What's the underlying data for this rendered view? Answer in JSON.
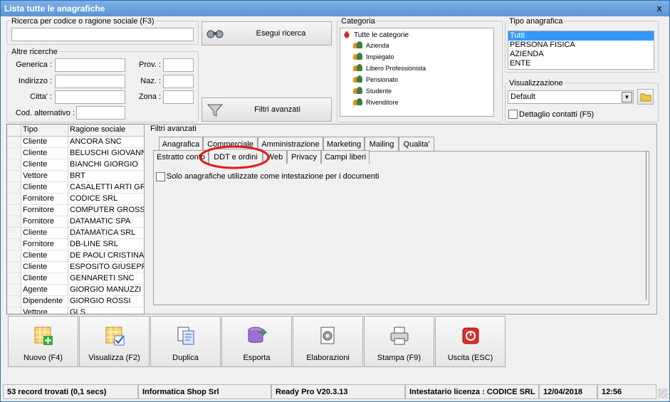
{
  "window": {
    "title": "Lista tutte le anagrafiche",
    "close_glyph": "x"
  },
  "search": {
    "legend": "Ricerca per codice o ragione sociale (F3)",
    "value": "",
    "button_label": "Esegui ricerca"
  },
  "altre": {
    "legend": "Altre ricerche",
    "generica_label": "Generica :",
    "indirizzo_label": "Indirizzo :",
    "citta_label": "Citta' :",
    "codalt_label": "Cod. alternativo :",
    "prov_label": "Prov. :",
    "naz_label": "Naz. :",
    "zona_label": "Zona :"
  },
  "filtri_button": "Filtri avanzati",
  "categoria": {
    "legend": "Categoria",
    "root": "Tutte le categorie",
    "items": [
      "Azienda",
      "Impiegato",
      "Libero Professionista",
      "Pensionato",
      "Studente",
      "Rivenditore"
    ]
  },
  "tipo": {
    "legend": "Tipo anagrafica",
    "items": [
      "Tutti",
      "PERSONA FISICA",
      "AZIENDA",
      "ENTE"
    ],
    "selected": "Tutti"
  },
  "visualizzazione": {
    "legend": "Visualizzazione",
    "value": "Default",
    "dettaglio_label": "Dettaglio contatti (F5)"
  },
  "grid": {
    "headers": [
      "Tipo",
      "Ragione sociale"
    ],
    "rows": [
      [
        "Cliente",
        "ANCORA SNC"
      ],
      [
        "Cliente",
        "BELUSCHI GIOVANNI"
      ],
      [
        "Cliente",
        "BIANCHI GIORGIO"
      ],
      [
        "Vettore",
        "BRT"
      ],
      [
        "Cliente",
        "CASALETTI ARTI GRA"
      ],
      [
        "Fornitore",
        "CODICE SRL"
      ],
      [
        "Fornitore",
        "COMPUTER GROSS SP"
      ],
      [
        "Fornitore",
        "DATAMATIC SPA"
      ],
      [
        "Cliente",
        "DATAMATICA SRL"
      ],
      [
        "Fornitore",
        "DB-LINE SRL"
      ],
      [
        "Cliente",
        "DE PAOLI CRISTINA"
      ],
      [
        "Cliente",
        "ESPOSITO GIUSEPPE"
      ],
      [
        "Cliente",
        "GENNARETI SNC"
      ],
      [
        "Agente",
        "GIORGIO MANUZZI (C"
      ],
      [
        "Dipendente",
        "GIORGIO ROSSI"
      ],
      [
        "Vettore",
        "GLS"
      ]
    ]
  },
  "filtri": {
    "title": "Filtri avanzati",
    "tabs_row1": [
      "Anagrafica",
      "Commerciale",
      "Amministrazione",
      "Marketing",
      "Mailing",
      "Qualita'"
    ],
    "tabs_row2": [
      "Estratto conto",
      "DDT e ordini",
      "Web",
      "Privacy",
      "Campi liberi"
    ],
    "active_tab": "DDT e ordini",
    "checkbox_label": "Solo anagrafiche utilizzate come intestazione per i documenti"
  },
  "toolbar": {
    "buttons": [
      "Nuovo (F4)",
      "Visualizza (F2)",
      "Duplica",
      "Esporta",
      "Elaborazioni",
      "Stampa (F9)",
      "Uscita (ESC)"
    ]
  },
  "status": {
    "records": "53 record trovati (0,1 secs)",
    "company": "Informatica Shop Srl",
    "version": "Ready Pro V20.3.13",
    "license": "Intestatario licenza : CODICE SRL",
    "date": "12/04/2018",
    "time": "12:56"
  },
  "colors": {
    "title_bar": "#5b95d6",
    "selection": "#3399ff",
    "highlight_ring": "#e31b1b"
  }
}
